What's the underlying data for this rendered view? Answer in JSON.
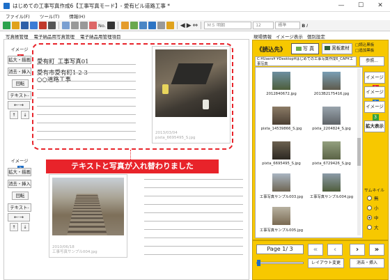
{
  "window": {
    "title": "はじめての工事写真作成6【工事写真モード】- 愛有ビル道路工事 *",
    "minimize": "—",
    "maximize": "☐",
    "close": "✕"
  },
  "menu": [
    "ファイル(F)",
    "ツール(T)",
    "情報(H)"
  ],
  "toolbar": {
    "no_label": "No.",
    "font_name": "ＭＳ 明朝",
    "font_size": "12",
    "style": "標準"
  },
  "tabs_left": [
    "写真帳管理",
    "電子納品用写真管理",
    "電子納品用管理項目"
  ],
  "tabs_right": [
    "現場情報",
    "イメージ表示",
    "個別設定"
  ],
  "image1": {
    "label": "イメージ",
    "num": "1",
    "buttons": {
      "enlarge": "拡大・描画",
      "delete": "消去・挿入",
      "rotate": "回転",
      "text": "テキスト-図"
    }
  },
  "image2": {
    "label": "イメージ",
    "num": "2",
    "buttons": {
      "enlarge": "拡大・描画",
      "delete": "消去・挿入",
      "rotate": "回転",
      "text": "テキスト-図"
    }
  },
  "memo1": {
    "line1": "愛有町_工事写真01",
    "line2": "愛有市愛有町1-2-3",
    "line3": "○○道路工事"
  },
  "photo1": {
    "caption1": "2013/03/04",
    "caption2": "pixta_6695495_S.jpg"
  },
  "photo2": {
    "caption1": "2010/06/18",
    "caption2": "工事写真サンプル004.jpg"
  },
  "callout": "テキストと写真が入れ替わりました",
  "loader": {
    "title": "《読込先》",
    "photo_tab": "写 真",
    "board_tab": "黒板素材",
    "check1": "□読込黒板",
    "check2": "□追加黒板",
    "path": "C:¥Users¥      ¥Desktop¥はじめての工事写真作成6_CAP¥工事写真",
    "browse": "参照..."
  },
  "thumbnails": [
    "2012840672.jpg",
    "2013B2175416.jpg",
    "pixta_14539866_S.jpg",
    "pixta_2204824_S.jpg",
    "pixta_6695495_S.jpg",
    "pixta_6729426_S.jpg",
    "工事写真サンプル003.jpg",
    "工事写真サンプル004.jpg",
    "工事写真サンプル005.jpg"
  ],
  "side_buttons": {
    "image1": "イメージ",
    "image2": "イメージ",
    "image3": "イメージ",
    "zoom": "拡大表示"
  },
  "thumbnail_size": {
    "label": "サムネイル",
    "options": [
      "無",
      "小",
      "中",
      "大"
    ],
    "selected": "中"
  },
  "pager": {
    "text": "Page 1/ 3",
    "layout_change": "レイアウト変更",
    "delete_insert": "消去・挿入"
  },
  "colors": {
    "accent": "#f7c800",
    "red": "#e8232a",
    "blue": "#1d6ec6",
    "green": "#33a23a"
  }
}
